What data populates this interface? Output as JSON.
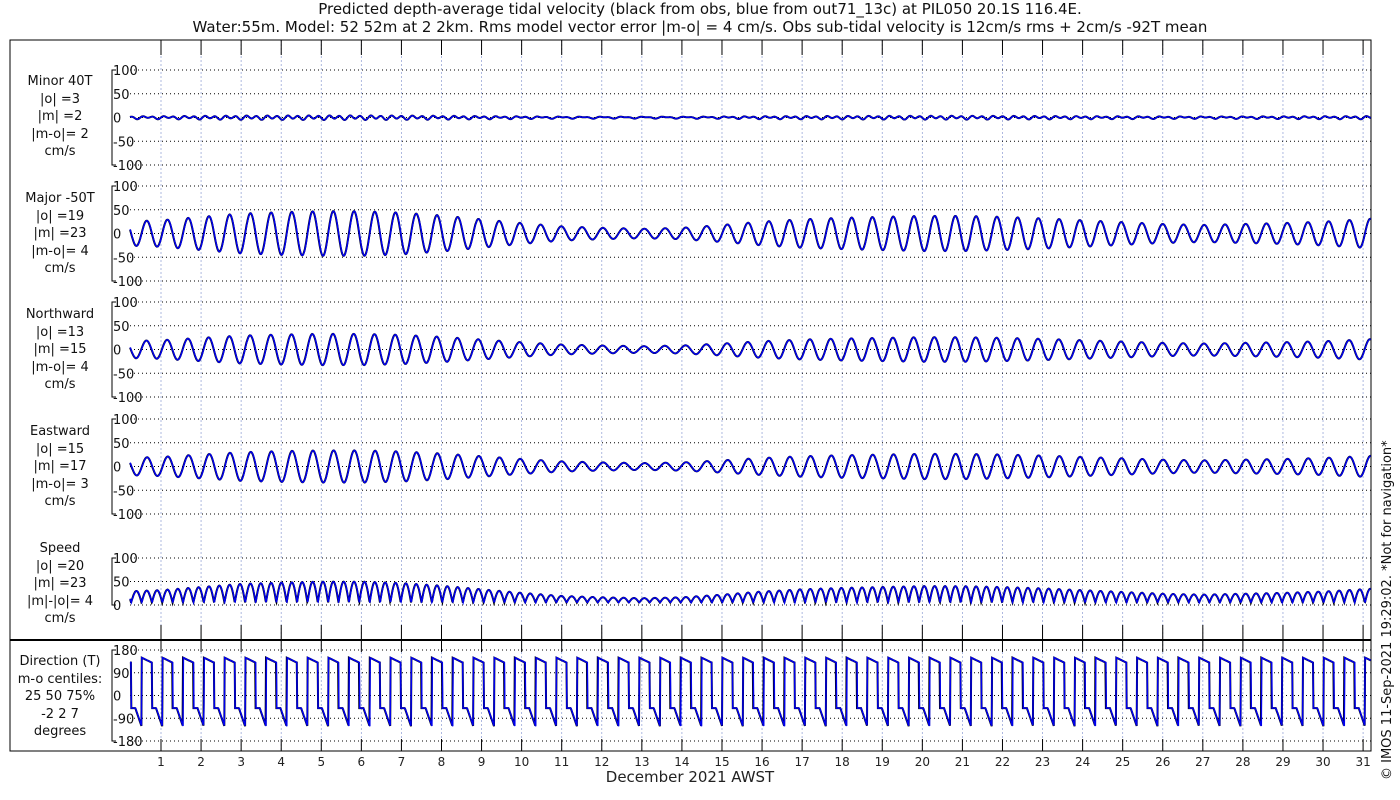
{
  "title_line1": "Predicted depth-average tidal velocity (black from obs, blue from out71_13c) at PIL050 20.1S 116.4E.",
  "title_line2": "Water:55m. Model: 52 52m at 2 2km. Rms model vector error |m-o| = 4 cm/s. Obs sub-tidal velocity is 12cm/s rms + 2cm/s -92T mean",
  "xlabel": "December 2021 AWST",
  "copyright": "© IMOS 11-Sep-2021 19:29:02. *Not for navigation*",
  "colors": {
    "obs": "#000000",
    "model": "#0000ee",
    "grid": "#9aa8d8"
  },
  "panels": [
    {
      "lines": [
        "Minor 40T",
        "|o| =3",
        "|m| =2",
        "|m-o|= 2",
        "cm/s"
      ]
    },
    {
      "lines": [
        "Major -50T",
        "|o| =19",
        "|m| =23",
        "|m-o|= 4",
        "cm/s"
      ]
    },
    {
      "lines": [
        "Northward",
        "|o| =13",
        "|m| =15",
        "|m-o|= 4",
        "cm/s"
      ]
    },
    {
      "lines": [
        "Eastward",
        "|o| =15",
        "|m| =17",
        "|m-o|= 3",
        "cm/s"
      ]
    },
    {
      "lines": [
        "Speed",
        "|o| =20",
        "|m| =23",
        "|m|-|o|= 4",
        "cm/s"
      ]
    },
    {
      "lines": [
        "Direction (T)",
        "m-o centiles:",
        "25  50  75%",
        "-2  2  7",
        "degrees"
      ]
    }
  ],
  "chart_data": {
    "type": "line",
    "x_ticks": [
      "1",
      "2",
      "3",
      "4",
      "5",
      "6",
      "7",
      "8",
      "9",
      "10",
      "11",
      "12",
      "13",
      "14",
      "15",
      "16",
      "17",
      "18",
      "19",
      "20",
      "21",
      "22",
      "23",
      "24",
      "25",
      "26",
      "27",
      "28",
      "29",
      "30",
      "31"
    ],
    "xlim": [
      0.23,
      31.2
    ],
    "tidal_period_hours": 12.42,
    "major_envelope_by_day": [
      25,
      28,
      35,
      42,
      45,
      47,
      47,
      44,
      38,
      30,
      22,
      15,
      12,
      10,
      12,
      18,
      25,
      30,
      33,
      35,
      37,
      37,
      35,
      32,
      28,
      24,
      20,
      18,
      20,
      22,
      25,
      30
    ],
    "series_scale": {
      "minor": 0.08,
      "major": 1.0,
      "northward": 0.7,
      "eastward": 0.72
    },
    "axes": [
      {
        "name": "minor",
        "ylim": [
          -100,
          100
        ],
        "yticks": [
          "100",
          "50",
          "0",
          "-50",
          "-100"
        ]
      },
      {
        "name": "major",
        "ylim": [
          -100,
          100
        ],
        "yticks": [
          "100",
          "50",
          "0",
          "-50",
          "-100"
        ]
      },
      {
        "name": "northward",
        "ylim": [
          -100,
          100
        ],
        "yticks": [
          "100",
          "50",
          "0",
          "-50",
          "-100"
        ]
      },
      {
        "name": "eastward",
        "ylim": [
          -100,
          100
        ],
        "yticks": [
          "100",
          "50",
          "0",
          "-50",
          "-100"
        ]
      },
      {
        "name": "speed",
        "ylim": [
          0,
          100
        ],
        "yticks": [
          "100",
          "50",
          "0"
        ]
      },
      {
        "name": "direction",
        "ylim": [
          -180,
          180
        ],
        "yticks": [
          "180",
          "90",
          "0",
          "-90",
          "-180"
        ]
      }
    ],
    "legend": [
      "black from obs",
      "blue from out71_13c"
    ]
  }
}
